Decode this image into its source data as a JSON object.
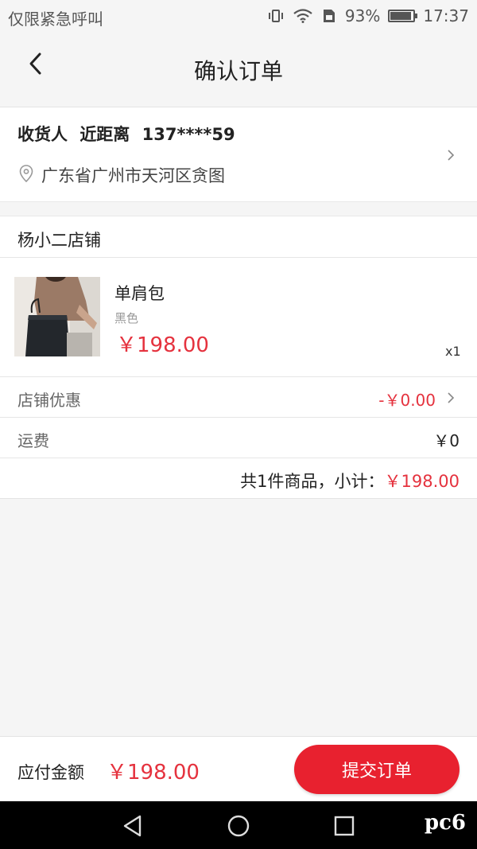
{
  "status_bar": {
    "left_text": "仅限紧急呼叫",
    "battery": "93%",
    "battery_level": 0.93,
    "time": "17:37",
    "icons": [
      "vibrate-icon",
      "wifi-icon",
      "sim-icon",
      "battery-icon"
    ]
  },
  "header": {
    "title": "确认订单",
    "back_icon": "back-arrow-icon"
  },
  "address": {
    "label": "收货人",
    "name": "近距离",
    "phone": "137****59",
    "location": "广东省广州市天河区贪图"
  },
  "shop": {
    "name": "杨小二店铺",
    "product": {
      "name": "单肩包",
      "color": "黑色",
      "price": "￥198.00",
      "quantity": "x1"
    },
    "discount": {
      "label": "店铺优惠",
      "value": "-￥0.00"
    },
    "shipping": {
      "label": "运费",
      "value": "￥0"
    },
    "subtotal": {
      "prefix": "共1件商品，小计：",
      "amount": "￥198.00"
    }
  },
  "footer": {
    "pay_label": "应付金额",
    "pay_amount": "￥198.00",
    "submit_label": "提交订单"
  },
  "nav": {
    "watermark": "pc6"
  },
  "colors": {
    "accent": "#e5323e",
    "button": "#e8212f",
    "background": "#f5f5f5"
  }
}
